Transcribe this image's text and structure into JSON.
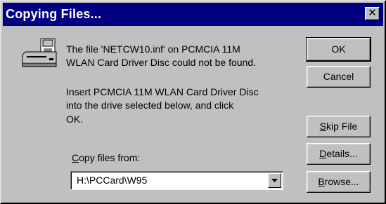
{
  "window": {
    "title": "Copying Files...",
    "close_glyph": "✕"
  },
  "message": {
    "line1": "The file 'NETCW10.inf' on PCMCIA 11M",
    "line2": "WLAN Card Driver Disc could not be found.",
    "line3": "Insert PCMCIA 11M WLAN Card Driver Disc",
    "line4": "into the drive selected below, and click",
    "line5": "OK."
  },
  "buttons": {
    "ok": "OK",
    "cancel": "Cancel",
    "skip_key": "S",
    "skip_rest": "kip File",
    "details_key": "D",
    "details_rest": "etails...",
    "browse_key": "B",
    "browse_rest": "rowse..."
  },
  "copy_from": {
    "label_key": "C",
    "label_rest": "opy files from:",
    "value": "H:\\PCCard\\W95"
  },
  "icons": {
    "disk": "floppy-drive-icon",
    "dropdown": "chevron-down-icon"
  },
  "colors": {
    "titlebar": "#000080",
    "face": "#c0c0c0"
  }
}
